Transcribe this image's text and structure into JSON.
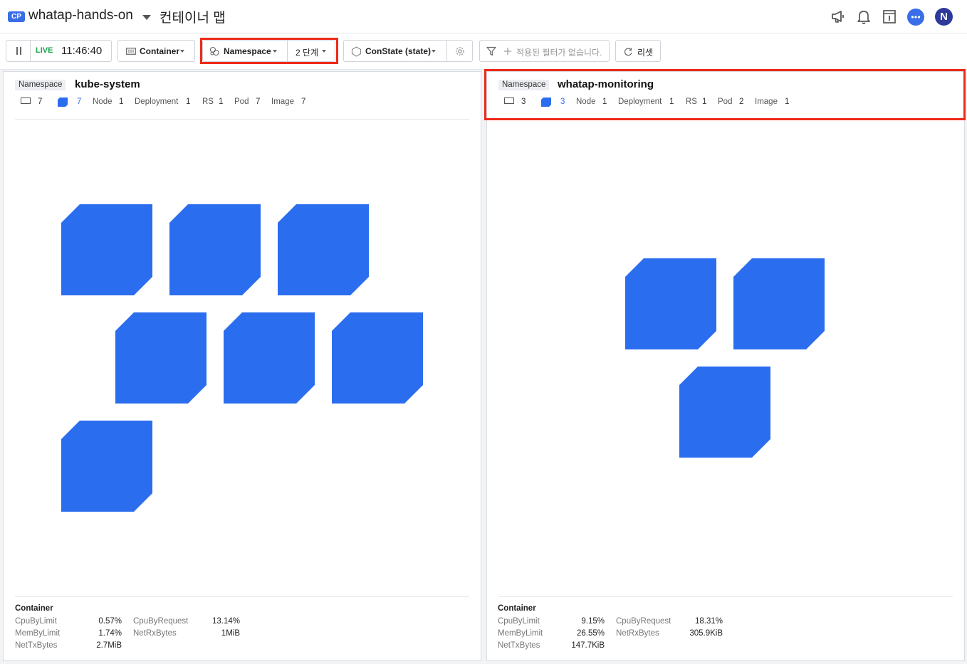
{
  "header": {
    "badge": "CP",
    "project": "whatap-hands-on",
    "title": "컨테이너 맵",
    "avatar_letter": "N"
  },
  "toolbar": {
    "live_label": "LIVE",
    "time": "11:46:40",
    "view_select": "Container",
    "group_select": "Namespace",
    "level_select": "2 단계",
    "state_select": "ConState (state)",
    "filter_placeholder": "적용된 필터가 없습니다.",
    "reset_label": "리셋"
  },
  "panels": [
    {
      "tag": "Namespace",
      "name": "kube-system",
      "stats": {
        "hosts": "7",
        "containers": "7",
        "node_label": "Node",
        "node": "1",
        "deployment_label": "Deployment",
        "deployment": "1",
        "rs_label": "RS",
        "rs": "1",
        "pod_label": "Pod",
        "pod": "7",
        "image_label": "Image",
        "image": "7"
      },
      "container_count": 7,
      "metrics": {
        "title": "Container",
        "cpu_by_limit_label": "CpuByLimit",
        "cpu_by_limit": "0.57%",
        "cpu_by_request_label": "CpuByRequest",
        "cpu_by_request": "13.14%",
        "mem_by_limit_label": "MemByLimit",
        "mem_by_limit": "1.74%",
        "net_rx_label": "NetRxBytes",
        "net_rx": "1MiB",
        "net_tx_label": "NetTxBytes",
        "net_tx": "2.7MiB"
      }
    },
    {
      "tag": "Namespace",
      "name": "whatap-monitoring",
      "stats": {
        "hosts": "3",
        "containers": "3",
        "node_label": "Node",
        "node": "1",
        "deployment_label": "Deployment",
        "deployment": "1",
        "rs_label": "RS",
        "rs": "1",
        "pod_label": "Pod",
        "pod": "2",
        "image_label": "Image",
        "image": "1"
      },
      "container_count": 3,
      "metrics": {
        "title": "Container",
        "cpu_by_limit_label": "CpuByLimit",
        "cpu_by_limit": "9.15%",
        "cpu_by_request_label": "CpuByRequest",
        "cpu_by_request": "18.31%",
        "mem_by_limit_label": "MemByLimit",
        "mem_by_limit": "26.55%",
        "net_rx_label": "NetRxBytes",
        "net_rx": "305.9KiB",
        "net_tx_label": "NetTxBytes",
        "net_tx": "147.7KiB"
      }
    }
  ],
  "colors": {
    "accent": "#2b6def",
    "live": "#1aa24a",
    "highlight": "#ee2a1a"
  }
}
